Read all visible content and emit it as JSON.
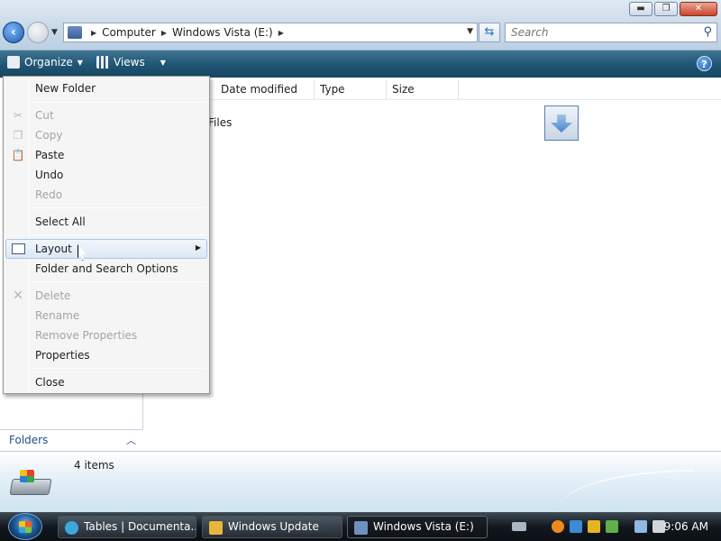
{
  "window": {
    "controls": {
      "minimize": "▬",
      "maximize": "❐",
      "close": "✕"
    }
  },
  "address": {
    "crumbs": [
      "Computer",
      "Windows Vista (E:)"
    ],
    "separator": "▶"
  },
  "search": {
    "placeholder": "Search"
  },
  "toolbar": {
    "organize_label": "Organize",
    "views_label": "Views",
    "help_label": "?"
  },
  "columns": [
    "Date modified",
    "Type",
    "Size"
  ],
  "files": [
    {
      "name": "Files"
    }
  ],
  "menu": {
    "items": [
      {
        "label": "New Folder",
        "disabled": false
      },
      {
        "label": "Cut",
        "disabled": true,
        "icon": "scissors-icon"
      },
      {
        "label": "Copy",
        "disabled": true,
        "icon": "copy-icon"
      },
      {
        "label": "Paste",
        "disabled": false,
        "icon": "clipboard-icon"
      },
      {
        "label": "Undo",
        "disabled": false
      },
      {
        "label": "Redo",
        "disabled": true
      },
      {
        "label": "Select All",
        "disabled": false
      },
      {
        "label": "Layout",
        "disabled": false,
        "icon": "layout-icon",
        "submenu": true,
        "hover": true
      },
      {
        "label": "Folder and Search Options",
        "disabled": false
      },
      {
        "label": "Delete",
        "disabled": true,
        "icon": "delete-x-icon"
      },
      {
        "label": "Rename",
        "disabled": true
      },
      {
        "label": "Remove Properties",
        "disabled": true
      },
      {
        "label": "Properties",
        "disabled": false
      },
      {
        "label": "Close",
        "disabled": false
      }
    ]
  },
  "navpane": {
    "folders_label": "Folders"
  },
  "details": {
    "items_count": "4 items"
  },
  "taskbar": {
    "tasks": [
      {
        "label": "Tables | Documenta...",
        "icon_color": "#3fa7e0"
      },
      {
        "label": "Windows Update",
        "icon_color": "#e7b63a"
      },
      {
        "label": "Windows Vista (E:)",
        "icon_color": "#6f8fbf"
      }
    ],
    "clock": "9:06 AM"
  },
  "colors": {
    "command_bar": "#1f5474",
    "menu_hover_border": "#a9c5e6",
    "disabled_text": "#a4a4a4",
    "link_blue": "#1e4f8c"
  }
}
